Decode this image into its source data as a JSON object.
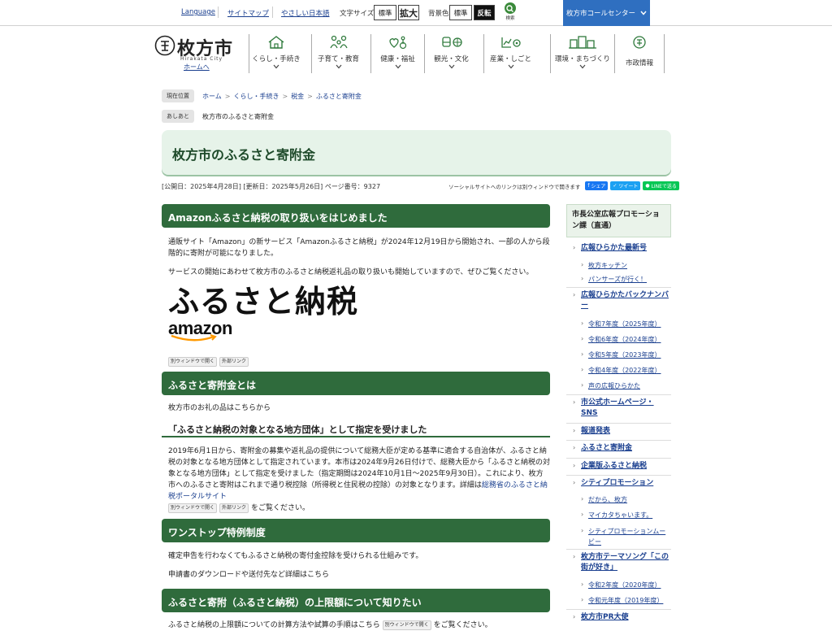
{
  "topbar": {
    "language": "Language",
    "sitemap": "サイトマップ",
    "easy_japanese": "やさしい日本語",
    "font_size_label": "文字サイズ",
    "font_standard": "標準",
    "font_large": "拡大",
    "bg_label": "背景色",
    "bg_standard": "標準",
    "bg_invert": "反転",
    "search_label": "検索",
    "call_center": "枚方市コールセンター"
  },
  "logo": {
    "name": "枚方市",
    "roman": "Hirakata City",
    "home": "ホームへ"
  },
  "nav": [
    {
      "label": "くらし・手続き"
    },
    {
      "label": "子育て・教育"
    },
    {
      "label": "健康・福祉"
    },
    {
      "label": "観光・文化"
    },
    {
      "label": "産業・しごと"
    },
    {
      "label": "環境・まちづくり"
    },
    {
      "label": "市政情報"
    }
  ],
  "breadcrumb": {
    "tag": "現在位置",
    "items": [
      "ホーム",
      "くらし・手続き",
      "税金",
      "ふるさと寄附金"
    ]
  },
  "ashiato": {
    "tag": "あしあと",
    "text": "枚方市のふるさと寄附金"
  },
  "page": {
    "title": "枚方市のふるさと寄附金",
    "published": "[公開日：2025年4月28日]",
    "updated": "[更新日：2025年5月26日]",
    "page_number": "ページ番号：9327"
  },
  "social": {
    "note": "ソーシャルサイトへのリンクは別ウィンドウで開きます",
    "facebook": "シェア",
    "twitter": "ツイート",
    "line": "LINEで送る",
    "colors": {
      "facebook": "#1877f2",
      "twitter": "#1da1f2",
      "line": "#06c755"
    }
  },
  "sections": {
    "s1": {
      "heading": "Amazonふるさと納税の取り扱いをはじめました",
      "p1": "通販サイト「Amazon」の新サービス「Amazonふるさと納税」が2024年12月19日から開始され、一部の人から段階的に寄附が可能になりました。",
      "p2": "サービスの開始にあわせて枚方市のふるさと納税返礼品の取り扱いも開始していますので、ぜひご覧ください。",
      "banner_text": "ふるさと納税",
      "banner_brand": "amazon",
      "ext1": "別ウィンドウで開く",
      "ext2": "外部リンク"
    },
    "s2": {
      "heading": "ふるさと寄附金とは",
      "link": "枚方市のお礼の品はこちらから",
      "subheading": "「ふるさと納税の対象となる地方団体」として指定を受けました",
      "p1": "2019年6月1日から、寄附金の募集や返礼品の提供について総務大臣が定める基準に適合する自治体が、ふるさと納税の対象となる地方団体として指定されています。本市は2024年9月26日付けで、総務大臣から「ふるさと納税の対象となる地方団体」として指定を受けました（指定期間は2024年10月1日～2025年9月30日）。これにより、枚方市へのふるさと寄附はこれまで通り税控除（所得税と住民税の控除）の対象となります。詳細は",
      "p1_link": "総務省のふるさと納税ポータルサイト",
      "ext1": "別ウィンドウで開く",
      "ext2": "外部リンク",
      "p1_end": "をご覧ください。"
    },
    "s3": {
      "heading": "ワンストップ特例制度",
      "p1": "確定申告を行わなくてもふるさと納税の寄付金控除を受けられる仕組みです。",
      "link": "申請書のダウンロードや送付先など詳細はこちら"
    },
    "s4": {
      "heading": "ふるさと寄附（ふるさと納税）の上限額について知りたい",
      "p1": "ふるさと納税の上限額についての計算方法や試算の手順はこちら",
      "ext1": "別ウィンドウで開く",
      "p1_end": "をご覧ください。"
    }
  },
  "sidebar": {
    "heading": "市長公室広報プロモーション課（直通）",
    "items": [
      {
        "label": "広報ひらかた最新号",
        "level": 1
      },
      {
        "label": "枚方キッチン",
        "level": 2
      },
      {
        "label": "パンサーズが行く！",
        "level": 2
      },
      {
        "label": "広報ひらかたバックナンバー",
        "level": 1
      },
      {
        "label": "令和7年度（2025年度）",
        "level": 2
      },
      {
        "label": "令和6年度（2024年度）",
        "level": 2
      },
      {
        "label": "令和5年度（2023年度）",
        "level": 2
      },
      {
        "label": "令和4年度（2022年度）",
        "level": 2
      },
      {
        "label": "声の広報ひらかた",
        "level": 2
      },
      {
        "label": "市公式ホームページ・SNS",
        "level": 1
      },
      {
        "label": "報道発表",
        "level": 1
      },
      {
        "label": "ふるさと寄附金",
        "level": 1
      },
      {
        "label": "企業版ふるさと納税",
        "level": 1
      },
      {
        "label": "シティプロモーション",
        "level": 1
      },
      {
        "label": "だから、枚方",
        "level": 2
      },
      {
        "label": "マイカタちゃいます。",
        "level": 2
      },
      {
        "label": "シティプロモーションムービー",
        "level": 2
      },
      {
        "label": "枚方市テーマソング「この街が好き」",
        "level": 1
      },
      {
        "label": "令和2年度（2020年度）",
        "level": 2
      },
      {
        "label": "令和元年度（2019年度）",
        "level": 2
      },
      {
        "label": "枚方市PR大使",
        "level": 1
      }
    ]
  }
}
